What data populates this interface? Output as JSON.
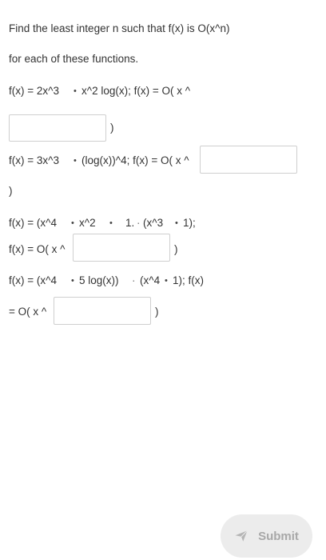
{
  "question": {
    "line1": "Find the least integer n such that f(x) is O(x^n)",
    "line2": "for each of these functions."
  },
  "items": [
    {
      "f_prefix": "f(x) = 2x^3",
      "bullet": "•",
      "f_rest": "x^2 log(x); f(x) = O( x ^",
      "answer_value": "",
      "close": ")"
    },
    {
      "f_prefix": "f(x) = 3x^3",
      "bullet": "•",
      "f_rest": "(log(x))^4; f(x) = O( x ^",
      "answer_value": "",
      "close": ")"
    },
    {
      "f_prefix": "f(x) = (x^4",
      "bullet": "•",
      "f_mid": "x^2",
      "bullet2": "•",
      "f_mid2": "1.",
      "mul": "·",
      "f_mid3": "(x^3",
      "bullet3": "•",
      "f_rest": "1);",
      "prefix2": "f(x) = O( x ^",
      "answer_value": "",
      "close": ")"
    },
    {
      "f_prefix": "f(x) = (x^4",
      "bullet": "•",
      "f_mid": "5 log(x))",
      "mul": "·",
      "f_mid2": "(x^4",
      "bullet2": "•",
      "f_rest": "1); f(x)",
      "prefix2": "= O( x ^",
      "answer_value": "",
      "close": ")"
    }
  ],
  "submit": {
    "label": "Submit",
    "icon": "paper-plane-icon"
  }
}
